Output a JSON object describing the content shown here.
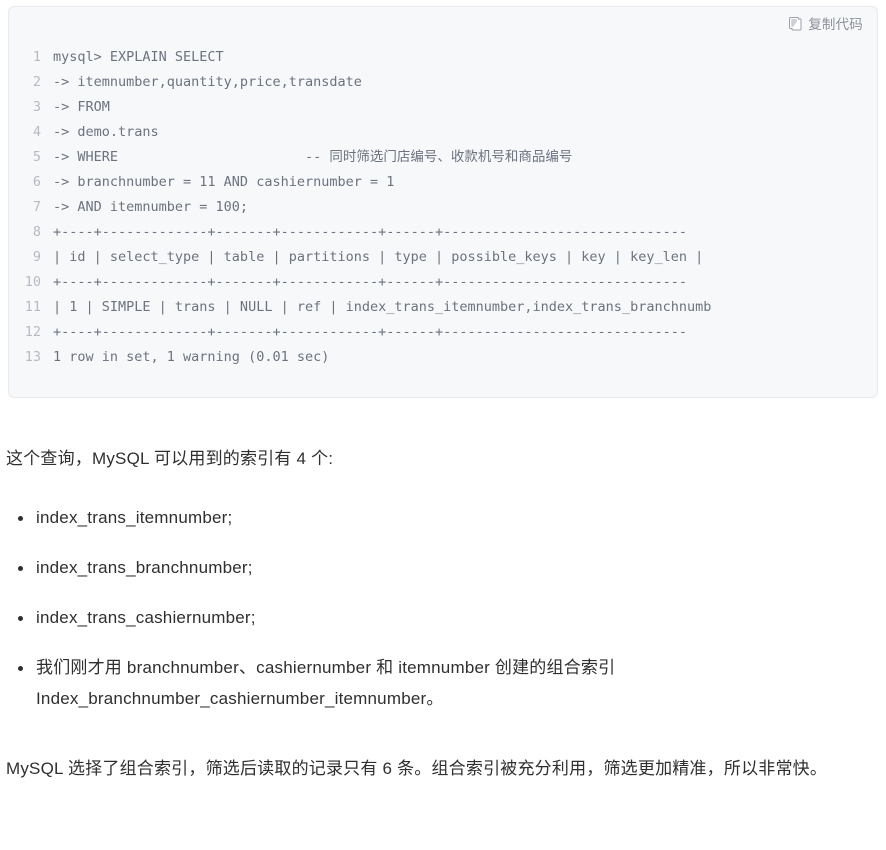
{
  "code_block": {
    "copy_button": {
      "label": "复制代码",
      "icon": "copy-icon"
    },
    "language": "sql",
    "lines": [
      {
        "number": "1",
        "text": "mysql> EXPLAIN SELECT"
      },
      {
        "number": "2",
        "text": "-> itemnumber,quantity,price,transdate"
      },
      {
        "number": "3",
        "text": "-> FROM"
      },
      {
        "number": "4",
        "text": "-> demo.trans"
      },
      {
        "number": "5",
        "text": "-> WHERE                       -- 同时筛选门店编号、收款机号和商品编号"
      },
      {
        "number": "6",
        "text": "-> branchnumber = 11 AND cashiernumber = 1"
      },
      {
        "number": "7",
        "text": "-> AND itemnumber = 100;"
      },
      {
        "number": "8",
        "text": "+----+-------------+-------+------------+------+------------------------------"
      },
      {
        "number": "9",
        "text": "| id | select_type | table | partitions | type | possible_keys | key | key_len |"
      },
      {
        "number": "10",
        "text": "+----+-------------+-------+------------+------+------------------------------"
      },
      {
        "number": "11",
        "text": "| 1 | SIMPLE | trans | NULL | ref | index_trans_itemnumber,index_trans_branchnumb"
      },
      {
        "number": "12",
        "text": "+----+-------------+-------+------------+------+------------------------------"
      },
      {
        "number": "13",
        "text": "1 row in set, 1 warning (0.01 sec)"
      }
    ]
  },
  "prose": {
    "intro": "这个查询，MySQL 可以用到的索引有 4 个:",
    "index_list": [
      "index_trans_itemnumber;",
      "index_trans_branchnumber;",
      "index_trans_cashiernumber;",
      "我们刚才用 branchnumber、cashiernumber 和 itemnumber 创建的组合索引 Index_branchnumber_cashiernumber_itemnumber。"
    ],
    "conclusion": "MySQL 选择了组合索引，筛选后读取的记录只有 6 条。组合索引被充分利用，筛选更加精准，所以非常快。"
  },
  "colors": {
    "code_background": "#f7f8fa",
    "code_border": "#e9eaee",
    "code_text": "#6b737f",
    "line_number": "#b6bac2",
    "body_text": "#2f2f2f",
    "copy_button": "#8a8f99"
  }
}
